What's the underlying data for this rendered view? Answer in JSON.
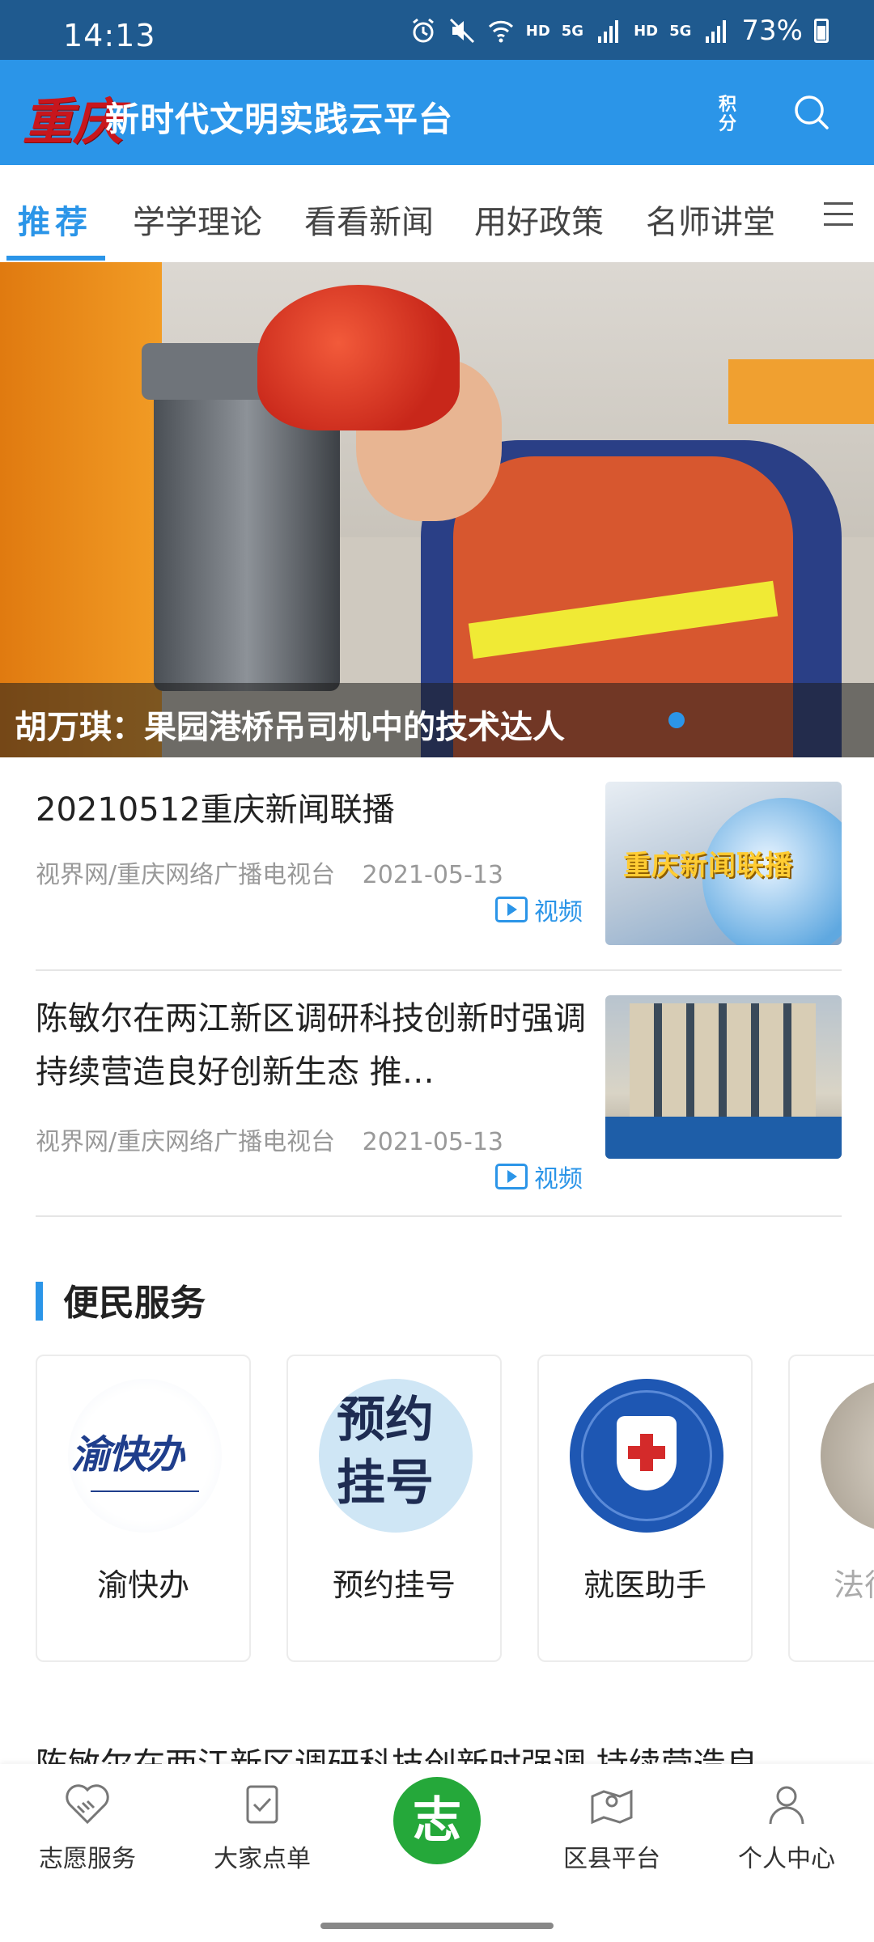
{
  "status_bar": {
    "time": "14:13",
    "battery": "73%",
    "hd1": "HD",
    "hd2": "HD",
    "net1": "5G",
    "net2": "5G"
  },
  "header": {
    "logo": "重庆",
    "title": "新时代文明实践云平台",
    "points_label": "积分",
    "search_icon": "search-icon"
  },
  "tabs": [
    {
      "label": "推荐",
      "active": true
    },
    {
      "label": "学学理论"
    },
    {
      "label": "看看新闻"
    },
    {
      "label": "用好政策"
    },
    {
      "label": "名师讲堂"
    }
  ],
  "banner": {
    "caption": "胡万琪：果园港桥吊司机中的技术达人"
  },
  "news": [
    {
      "title": "20210512重庆新闻联播",
      "source": "视界网/重庆网络广播电视台",
      "date": "2021-05-13",
      "tag": "视频",
      "thumb_text": "重庆新闻联播"
    },
    {
      "title": "陈敏尔在两江新区调研科技创新时强调 持续营造良好创新生态 推…",
      "source": "视界网/重庆网络广播电视台",
      "date": "2021-05-13",
      "tag": "视频"
    }
  ],
  "services": {
    "title": "便民服务",
    "items": [
      {
        "label": "渝快办",
        "icon_text": "渝快办"
      },
      {
        "label": "预约挂号",
        "icon_text_1": "预约",
        "icon_text_2": "挂号"
      },
      {
        "label": "就医助手"
      },
      {
        "label": "法律"
      }
    ]
  },
  "partial_text": "陈敏尔在两江新区调研科技创新时强调 持续营造良",
  "bottom_nav": [
    {
      "label": "志愿服务",
      "icon": "handshake-heart-icon"
    },
    {
      "label": "大家点单",
      "icon": "checklist-icon"
    },
    {
      "label": "志",
      "icon": "volunteer-logo-icon"
    },
    {
      "label": "区县平台",
      "icon": "map-pin-icon"
    },
    {
      "label": "个人中心",
      "icon": "person-icon"
    }
  ],
  "colors": {
    "accent": "#2b95e8",
    "status_bar": "#1f5a8f",
    "green": "#25a83a"
  }
}
